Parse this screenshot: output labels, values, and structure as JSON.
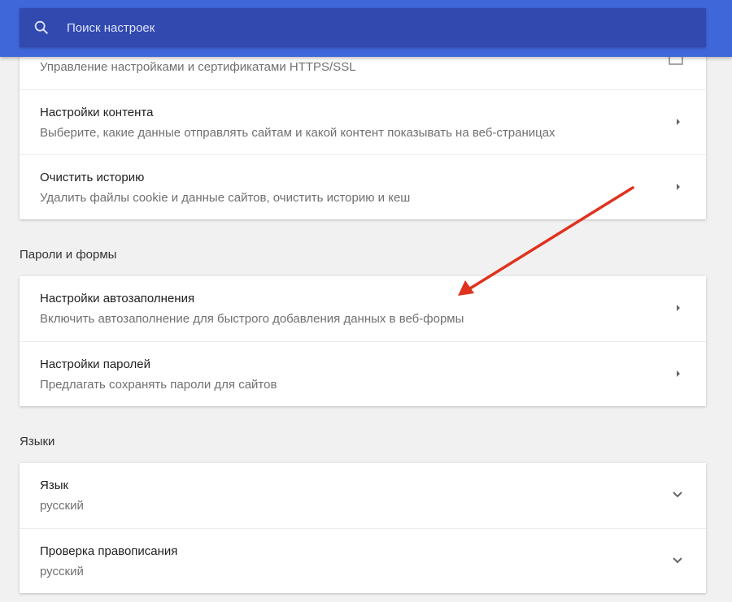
{
  "search": {
    "placeholder": "Поиск настроек"
  },
  "card1": [
    {
      "subtitle": "Управление настройками и сертификатами HTTPS/SSL"
    },
    {
      "title": "Настройки контента",
      "subtitle": "Выберите, какие данные отправлять сайтам и какой контент показывать на веб-страницах"
    },
    {
      "title": "Очистить историю",
      "subtitle": "Удалить файлы cookie и данные сайтов, очистить историю и кеш"
    }
  ],
  "passwords": {
    "heading": "Пароли и формы",
    "items": [
      {
        "title": "Настройки автозаполнения",
        "subtitle": "Включить автозаполнение для быстрого добавления данных в веб-формы"
      },
      {
        "title": "Настройки паролей",
        "subtitle": "Предлагать сохранять пароли для сайтов"
      }
    ]
  },
  "languages": {
    "heading": "Языки",
    "items": [
      {
        "title": "Язык",
        "subtitle": "русский"
      },
      {
        "title": "Проверка правописания",
        "subtitle": "русский"
      }
    ]
  },
  "colors": {
    "header": "#3f67d9",
    "search": "#3249b0",
    "arrow": "#e0321e"
  }
}
